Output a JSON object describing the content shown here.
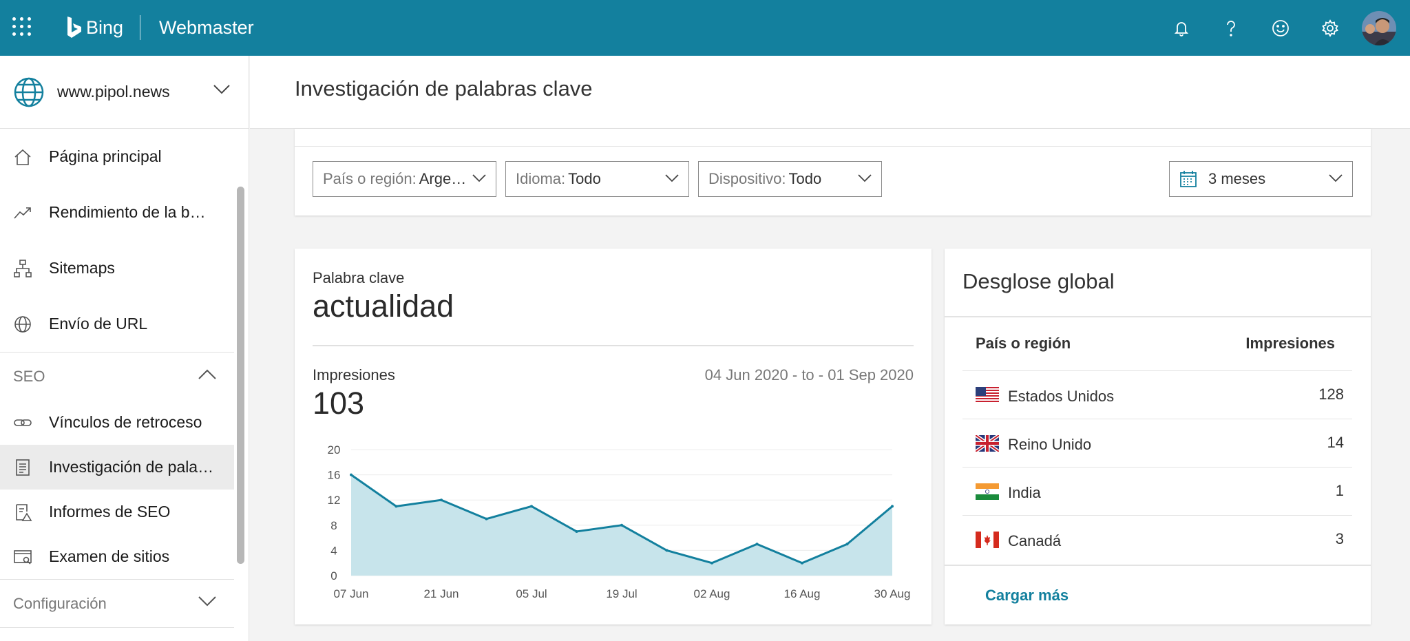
{
  "app": {
    "brand": "Bing",
    "product": "Webmaster"
  },
  "topbar_icons": [
    "bell-icon",
    "help-icon",
    "feedback-smile-icon",
    "gear-icon",
    "avatar"
  ],
  "sidebar": {
    "site": "www.pipol.news",
    "items": [
      {
        "label": "Página principal",
        "icon": "home-icon"
      },
      {
        "label": "Rendimiento de la bú…",
        "icon": "trend-icon"
      },
      {
        "label": "Sitemaps",
        "icon": "sitemap-icon"
      },
      {
        "label": "Envío de URL",
        "icon": "globe-icon"
      }
    ],
    "seo_section": "SEO",
    "seo_items": [
      {
        "label": "Vínculos de retroceso",
        "icon": "link-icon"
      },
      {
        "label": "Investigación de pala…",
        "icon": "document-icon",
        "active": true
      },
      {
        "label": "Informes de SEO",
        "icon": "report-icon"
      },
      {
        "label": "Examen de sitios",
        "icon": "site-scan-icon"
      }
    ],
    "config_section": "Configuración"
  },
  "page": {
    "title": "Investigación de palabras clave"
  },
  "filters": {
    "country_key": "País o región:",
    "country_value": "Arge…",
    "language_key": "Idioma:",
    "language_value": "Todo",
    "device_key": "Dispositivo:",
    "device_value": "Todo",
    "period": "3 meses"
  },
  "keyword_card": {
    "keyword_label": "Palabra clave",
    "keyword": "actualidad",
    "impressions_label": "Impresiones",
    "impressions": "103",
    "date_range": "04 Jun 2020 - to - 01 Sep 2020"
  },
  "chart_data": {
    "type": "area",
    "title": "",
    "xlabel": "",
    "ylabel": "",
    "ylim": [
      0,
      20
    ],
    "yticks": [
      0,
      4,
      8,
      12,
      16,
      20
    ],
    "xtick_labels": [
      "07 Jun",
      "21 Jun",
      "05 Jul",
      "19 Jul",
      "02 Aug",
      "16 Aug",
      "30 Aug"
    ],
    "x": [
      "07 Jun",
      "14 Jun",
      "21 Jun",
      "28 Jun",
      "05 Jul",
      "12 Jul",
      "19 Jul",
      "26 Jul",
      "02 Aug",
      "09 Aug",
      "16 Aug",
      "23 Aug",
      "30 Aug"
    ],
    "values": [
      16,
      11,
      12,
      9,
      11,
      7,
      8,
      4,
      2,
      5,
      2,
      5,
      11
    ],
    "grid": true,
    "colors": {
      "line": "#13809e",
      "fill": "#c7e4eb"
    }
  },
  "breakdown": {
    "title": "Desglose global",
    "col_country": "País o región",
    "col_impressions": "Impresiones",
    "rows": [
      {
        "country": "Estados Unidos",
        "impressions": "128",
        "flag": "us-flag-icon"
      },
      {
        "country": "Reino Unido",
        "impressions": "14",
        "flag": "uk-flag-icon"
      },
      {
        "country": "India",
        "impressions": "1",
        "flag": "india-flag-icon"
      },
      {
        "country": "Canadá",
        "impressions": "3",
        "flag": "canada-flag-icon"
      }
    ],
    "load_more": "Cargar más"
  },
  "colors": {
    "accent": "#13809e",
    "page_bg": "#f3f3f3"
  }
}
